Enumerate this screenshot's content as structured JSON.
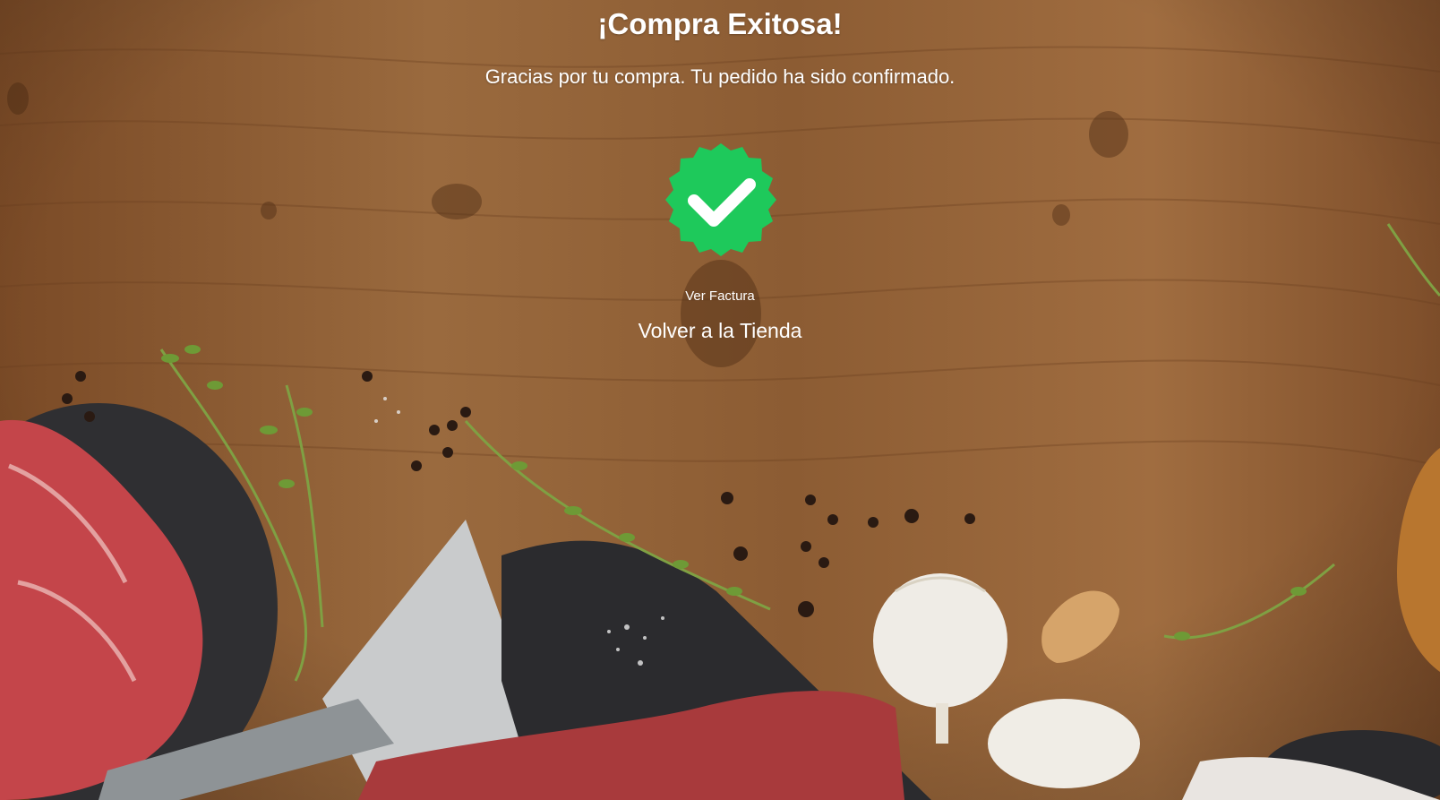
{
  "header": {
    "title": "¡Compra Exitosa!",
    "subtitle": "Gracias por tu compra. Tu pedido ha sido confirmado."
  },
  "badge": {
    "icon": "check-badge-icon",
    "color": "#1ec95b"
  },
  "actions": {
    "invoice_label": "Ver Factura",
    "store_label": "Volver a la Tienda"
  },
  "background": {
    "image": "wooden-table-with-meat-garlic-herbs"
  }
}
